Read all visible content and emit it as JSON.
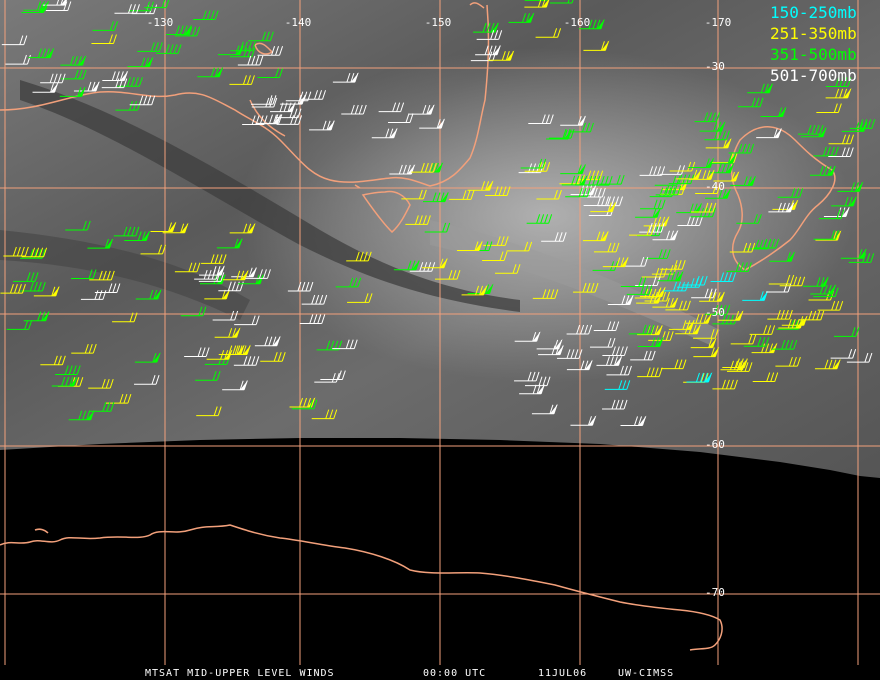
{
  "title_footer": {
    "product": "MTSAT MID-UPPER LEVEL WINDS",
    "time": "00:00 UTC",
    "date": "11JUL06",
    "credit": "UW-CIMSS"
  },
  "legend": [
    {
      "label": "150-250mb",
      "color": "#00ffff"
    },
    {
      "label": "251-350mb",
      "color": "#ffff00"
    },
    {
      "label": "351-500mb",
      "color": "#00ff00"
    },
    {
      "label": "501-700mb",
      "color": "#ffffff"
    }
  ],
  "longitude_labels": [
    "-130",
    "-140",
    "-150",
    "-160",
    "-170"
  ],
  "latitude_labels": [
    "-30",
    "-40",
    "-50",
    "-60",
    "-70"
  ],
  "colors": {
    "coastline": "#f2a07b",
    "grid": "#f2a07b",
    "earth_limb_bg": "#000000"
  }
}
